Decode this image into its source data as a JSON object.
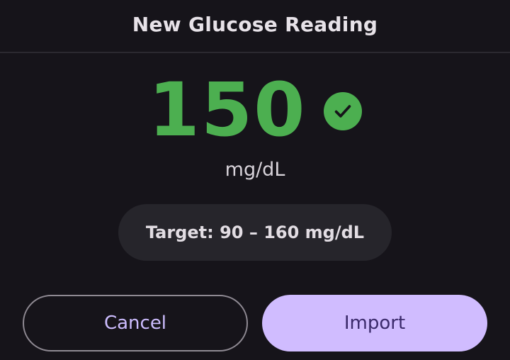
{
  "dialog": {
    "title": "New Glucose Reading"
  },
  "reading": {
    "value": "150",
    "unit": "mg/dL",
    "status_icon": "check-circle-icon",
    "status_color": "#4caf50"
  },
  "target": {
    "label": "Target: 90 – 160 mg/dL"
  },
  "actions": {
    "cancel_label": "Cancel",
    "import_label": "Import",
    "primary_color": "#d0bcff"
  }
}
